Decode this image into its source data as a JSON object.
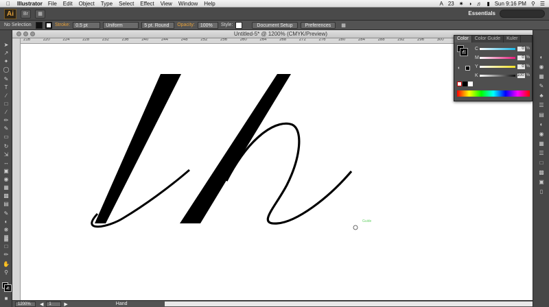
{
  "menubar": {
    "apple": "",
    "app_name": "Illustrator",
    "items": [
      "File",
      "Edit",
      "Object",
      "Type",
      "Select",
      "Effect",
      "View",
      "Window",
      "Help"
    ],
    "status_num": "23",
    "clock": "Sun 9:16 PM"
  },
  "appbar": {
    "logo": "Ai",
    "workspace": "Essentials"
  },
  "controlbar": {
    "selection": "No Selection",
    "stroke_label": "Stroke:",
    "stroke_weight": "0.5 pt",
    "variable_width": "Uniform",
    "brush": "5 pt. Round",
    "opacity_label": "Opacity:",
    "opacity_value": "100%",
    "style_label": "Style:",
    "doc_setup": "Document Setup",
    "preferences": "Preferences"
  },
  "document": {
    "title": "Untitled-5* @ 1200% (CMYK/Preview)"
  },
  "ruler": {
    "h_ticks": [
      "216",
      "220",
      "224",
      "228",
      "232",
      "236",
      "240",
      "244",
      "248",
      "252",
      "256",
      "260",
      "264",
      "268",
      "272",
      "276",
      "280",
      "284",
      "288",
      "292",
      "296",
      "300",
      "304",
      "308",
      "312",
      "316"
    ]
  },
  "canvas": {
    "cursor_tooltip": "Guide",
    "artwork_letters": "lh"
  },
  "color_panel": {
    "tabs": [
      "Color",
      "Color Guide",
      "Kuler"
    ],
    "channels": [
      {
        "label": "C",
        "value": "0",
        "color": "#19b6e6"
      },
      {
        "label": "M",
        "value": "0",
        "color": "#e6197a"
      },
      {
        "label": "Y",
        "value": "0",
        "color": "#f2e024"
      },
      {
        "label": "K",
        "value": "100",
        "color": "#111111"
      }
    ],
    "percent": "%"
  },
  "statusbar": {
    "zoom": "1200%",
    "artboard": "1",
    "tool": "Hand"
  },
  "colors": {
    "ai_orange": "#e3a13d",
    "panel_bg": "#4f4f4f",
    "canvas": "#ffffff"
  }
}
